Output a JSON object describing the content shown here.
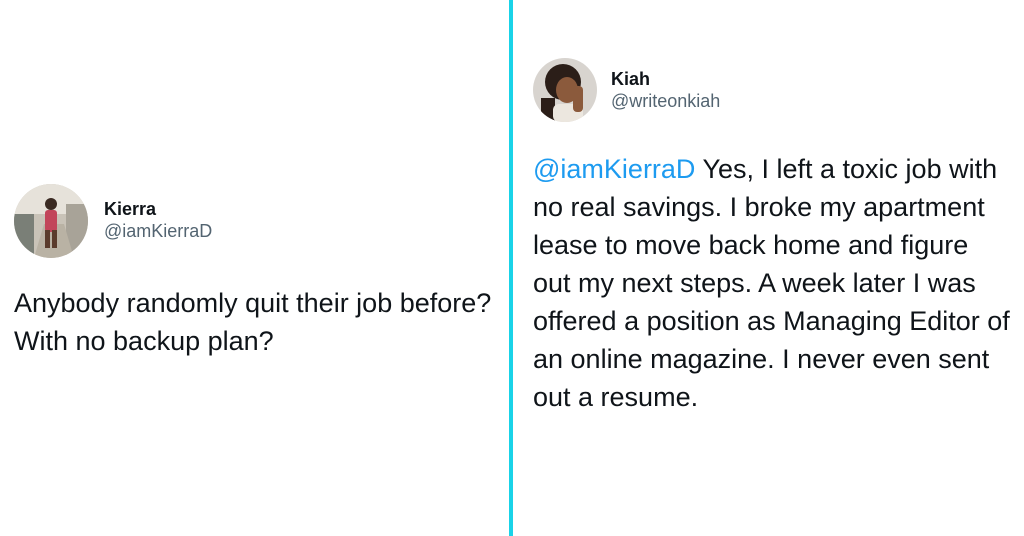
{
  "left_tweet": {
    "display_name": "Kierra",
    "handle": "@iamKierraD",
    "text": "Anybody randomly quit their job before? With no backup plan?",
    "avatar_icon": "profile-photo-avatar"
  },
  "right_tweet": {
    "display_name": "Kiah",
    "handle": "@writeonkiah",
    "mention": "@iamKierraD",
    "text": " Yes, I left a toxic job with no real savings. I broke my apartment lease to move back home and figure out my next steps. A week later I was offered a position as Managing Editor of an online magazine. I never even sent out a resume.",
    "avatar_icon": "profile-photo-avatar"
  },
  "colors": {
    "divider": "#19d3e8",
    "mention": "#1d9bf0",
    "text": "#0f1419",
    "handle": "#536471"
  }
}
